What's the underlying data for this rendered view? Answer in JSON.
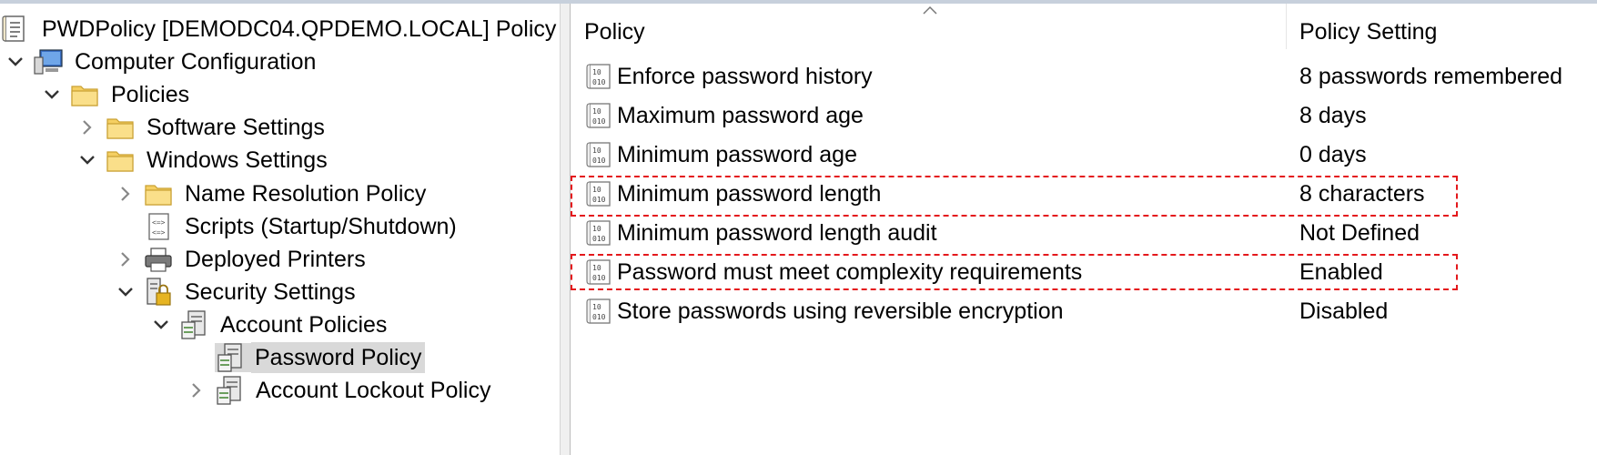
{
  "tree": {
    "items": [
      {
        "label": "PWDPolicy [DEMODC04.QPDEMO.LOCAL] Policy",
        "icon": "policy-scroll-icon"
      },
      {
        "label": "Computer Configuration",
        "icon": "computer-icon",
        "expanded": true
      },
      {
        "label": "Policies",
        "icon": "folder-icon",
        "expanded": true
      },
      {
        "label": "Software Settings",
        "icon": "folder-icon",
        "expanded": false
      },
      {
        "label": "Windows Settings",
        "icon": "folder-icon",
        "expanded": true
      },
      {
        "label": "Name Resolution Policy",
        "icon": "folder-icon",
        "expanded": false
      },
      {
        "label": "Scripts (Startup/Shutdown)",
        "icon": "script-icon"
      },
      {
        "label": "Deployed Printers",
        "icon": "printer-icon",
        "expanded": false
      },
      {
        "label": "Security Settings",
        "icon": "security-settings-icon",
        "expanded": true
      },
      {
        "label": "Account Policies",
        "icon": "account-policies-icon",
        "expanded": true
      },
      {
        "label": "Password Policy",
        "icon": "account-policies-icon",
        "selected": true
      },
      {
        "label": "Account Lockout Policy",
        "icon": "account-policies-icon",
        "expanded": false
      }
    ]
  },
  "list": {
    "headers": {
      "policy": "Policy",
      "setting": "Policy Setting"
    },
    "rows": [
      {
        "policy": "Enforce password history",
        "setting": "8 passwords remembered"
      },
      {
        "policy": "Maximum password age",
        "setting": "8 days"
      },
      {
        "policy": "Minimum password age",
        "setting": "0 days"
      },
      {
        "policy": "Minimum password length",
        "setting": "8 characters",
        "highlighted": true
      },
      {
        "policy": "Minimum password length audit",
        "setting": "Not Defined"
      },
      {
        "policy": "Password must meet complexity requirements",
        "setting": "Enabled",
        "highlighted": true
      },
      {
        "policy": "Store passwords using reversible encryption",
        "setting": "Disabled"
      }
    ]
  },
  "colors": {
    "highlight": "#e4181c",
    "selected_bg": "#d9d9d9",
    "folder": "#f5cf62"
  }
}
